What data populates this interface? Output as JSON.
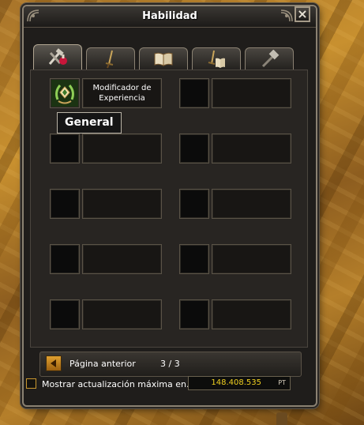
{
  "window": {
    "title": "Habilidad",
    "close_glyph": "×"
  },
  "tabs": [
    {
      "name": "skills-general",
      "icon": "tools-potion-icon",
      "active": true
    },
    {
      "name": "skills-weapon",
      "icon": "sword-icon",
      "active": false
    },
    {
      "name": "skills-book",
      "icon": "book-icon",
      "active": false
    },
    {
      "name": "skills-weapon-book",
      "icon": "sword-book-icon",
      "active": false
    },
    {
      "name": "skills-craft",
      "icon": "hammer-icon",
      "active": false
    }
  ],
  "skills": [
    {
      "label": "Modificador de Experiencia",
      "icon": "laurel-wreath-icon"
    },
    {
      "label": ""
    },
    {
      "label": ""
    },
    {
      "label": ""
    },
    {
      "label": ""
    },
    {
      "label": ""
    },
    {
      "label": ""
    },
    {
      "label": ""
    },
    {
      "label": ""
    },
    {
      "label": ""
    }
  ],
  "tooltip": {
    "text": "General"
  },
  "pager": {
    "prev_label": "Página anterior",
    "page_count": "3 / 3"
  },
  "footer": {
    "checkbox_label": "Mostrar actualización máxima en...",
    "points_value": "148.408.535",
    "points_unit": "PT"
  },
  "colors": {
    "accent": "#c9972f",
    "points": "#f0d020"
  }
}
